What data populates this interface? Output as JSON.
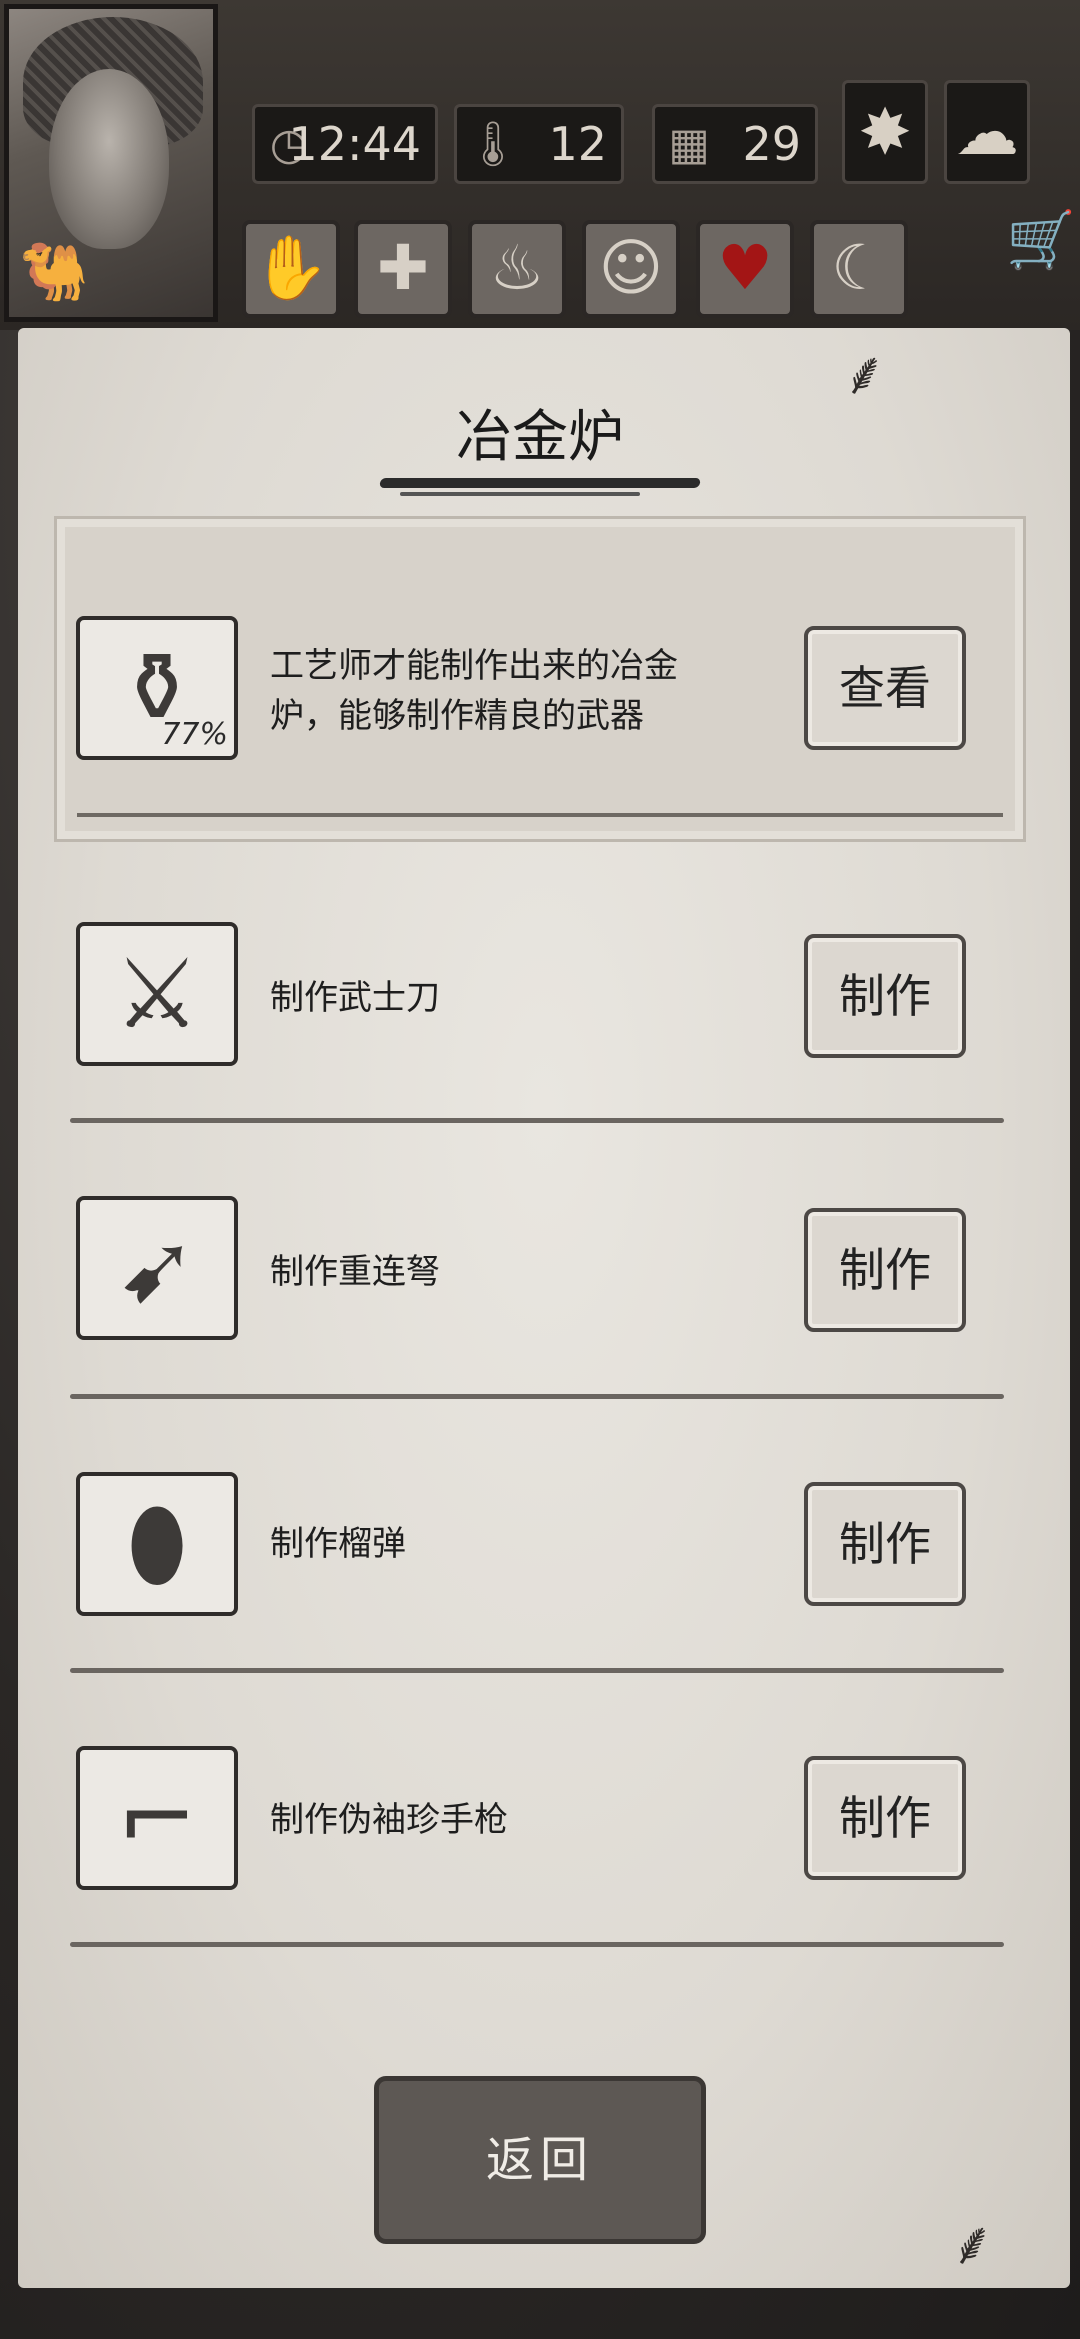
{
  "hud": {
    "time": "12:44",
    "temperature": "12",
    "day": "29",
    "icons": {
      "clock": "clock-icon",
      "thermometer": "thermometer-icon",
      "calendar": "calendar-icon",
      "leaf": "leaf-icon",
      "rain": "rain-cloud-icon",
      "camel": "camel-icon",
      "cart": "cart-icon"
    },
    "status_icons": [
      "hand-bandage-icon",
      "medical-cross-icon",
      "stomach-icon",
      "head-icon",
      "heart-icon",
      "moon-icon"
    ]
  },
  "page": {
    "title": "冶金炉"
  },
  "feature": {
    "description_line1": "工艺师才能制作出来的冶金",
    "description_line2": "炉，能够制作精良的武器",
    "progress": "77%",
    "button_label": "查看"
  },
  "recipes": [
    {
      "label": "制作武士刀",
      "button": "制作",
      "icon": "katana-icon"
    },
    {
      "label": "制作重连弩",
      "button": "制作",
      "icon": "crossbow-icon"
    },
    {
      "label": "制作榴弹",
      "button": "制作",
      "icon": "grenade-icon"
    },
    {
      "label": "制作伪袖珍手枪",
      "button": "制作",
      "icon": "revolver-icon"
    }
  ],
  "back_label": "返回"
}
